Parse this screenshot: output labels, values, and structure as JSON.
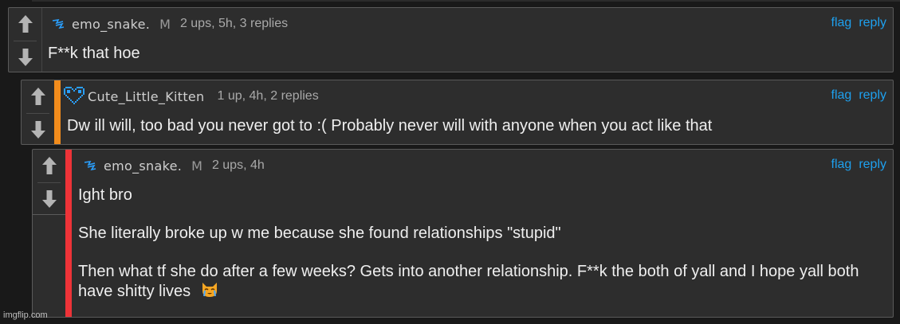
{
  "comments": [
    {
      "username": "emo_snake.",
      "badge": "M",
      "meta": "2 ups, 5h, 3 replies",
      "text": "F**k that hoe",
      "actions": {
        "flag": "flag",
        "reply": "reply"
      }
    },
    {
      "username": "Cute_Little_Kitten",
      "badge": "",
      "meta": "1 up, 4h, 2 replies",
      "text": "Dw ill will, too bad you never got to :( Probably never will with anyone when you act like that",
      "actions": {
        "flag": "flag",
        "reply": "reply"
      }
    },
    {
      "username": "emo_snake.",
      "badge": "M",
      "meta": "2 ups, 4h",
      "paragraphs": [
        "Ight bro",
        "She literally broke up w me because she found relationships \"stupid\"",
        "Then what tf she do after a few weeks? Gets into another relationship. F**k the both of yall and I hope yall both have shitty lives"
      ],
      "actions": {
        "flag": "flag",
        "reply": "reply"
      }
    }
  ],
  "stripe_colors": {
    "level2": "#f28c1c",
    "level3": "#ee3338"
  },
  "icons": {
    "upvote": "arrow-up-icon",
    "downvote": "arrow-down-icon",
    "user1": "lightning-icon",
    "user2": "pixel-heart-icon",
    "emoji": "crying-cat-emoji"
  },
  "watermark": "imgflip.com"
}
